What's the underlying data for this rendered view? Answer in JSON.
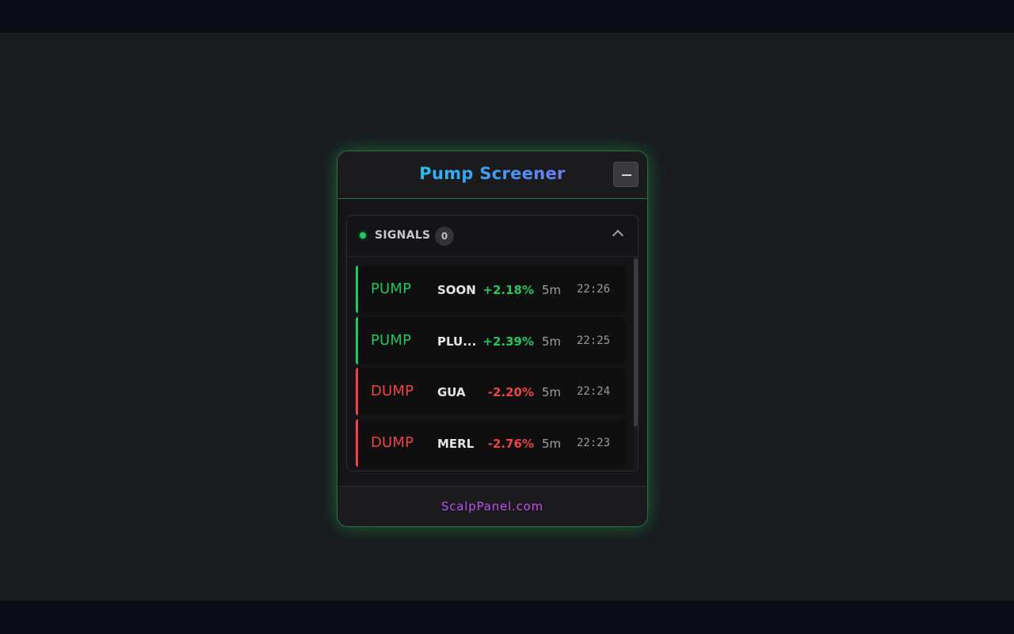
{
  "header": {
    "title": "Pump Screener",
    "minimize_icon": "minus-icon"
  },
  "signals": {
    "label": "SIGNALS",
    "count": "0",
    "status_color": "#22c55e",
    "collapse_icon": "chevron-up-icon",
    "items": [
      {
        "type": "PUMP",
        "symbol": "SOON",
        "change": "+2.18%",
        "timeframe": "5m",
        "time": "22:26"
      },
      {
        "type": "PUMP",
        "symbol": "PLU...",
        "change": "+2.39%",
        "timeframe": "5m",
        "time": "22:25"
      },
      {
        "type": "DUMP",
        "symbol": "GUA",
        "change": "-2.20%",
        "timeframe": "5m",
        "time": "22:24"
      },
      {
        "type": "DUMP",
        "symbol": "MERL",
        "change": "-2.76%",
        "timeframe": "5m",
        "time": "22:23"
      }
    ]
  },
  "footer": {
    "link": "ScalpPanel.com"
  },
  "colors": {
    "pump": "#22c55e",
    "dump": "#ef4444",
    "accent_border": "#2e6b45"
  }
}
